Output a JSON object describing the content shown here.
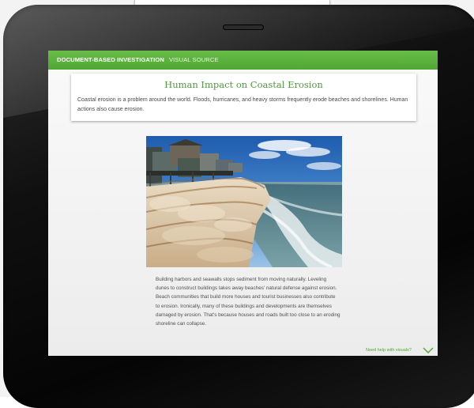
{
  "header": {
    "section": "DOCUMENT-BASED INVESTIGATION",
    "subsection": "VISUAL SOURCE"
  },
  "card": {
    "title": "Human Impact on Coastal Erosion",
    "desc": "Coastal erosion is a problem around the world. Floods, hurricanes, and heavy storms frequently erode beaches and shorelines. Human actions also cause erosion."
  },
  "caption": "Building harbors and seawalls stops sediment from moving naturally. Leveling dunes to construct buildings takes away beaches' natural defense against erosion. Beach communities that build more houses and tourist businesses also contribute to erosion. Ironically, many of these buildings and developments are themselves damaged by erosion. That's because houses and roads built too close to an eroding shoreline can collapse.",
  "help": {
    "label": "Need help with visuals?",
    "icon": "chevron-down-icon"
  },
  "colors": {
    "accent": "#56ad3b",
    "title": "#4e9a3a",
    "bezel": "#0b0b0b"
  }
}
